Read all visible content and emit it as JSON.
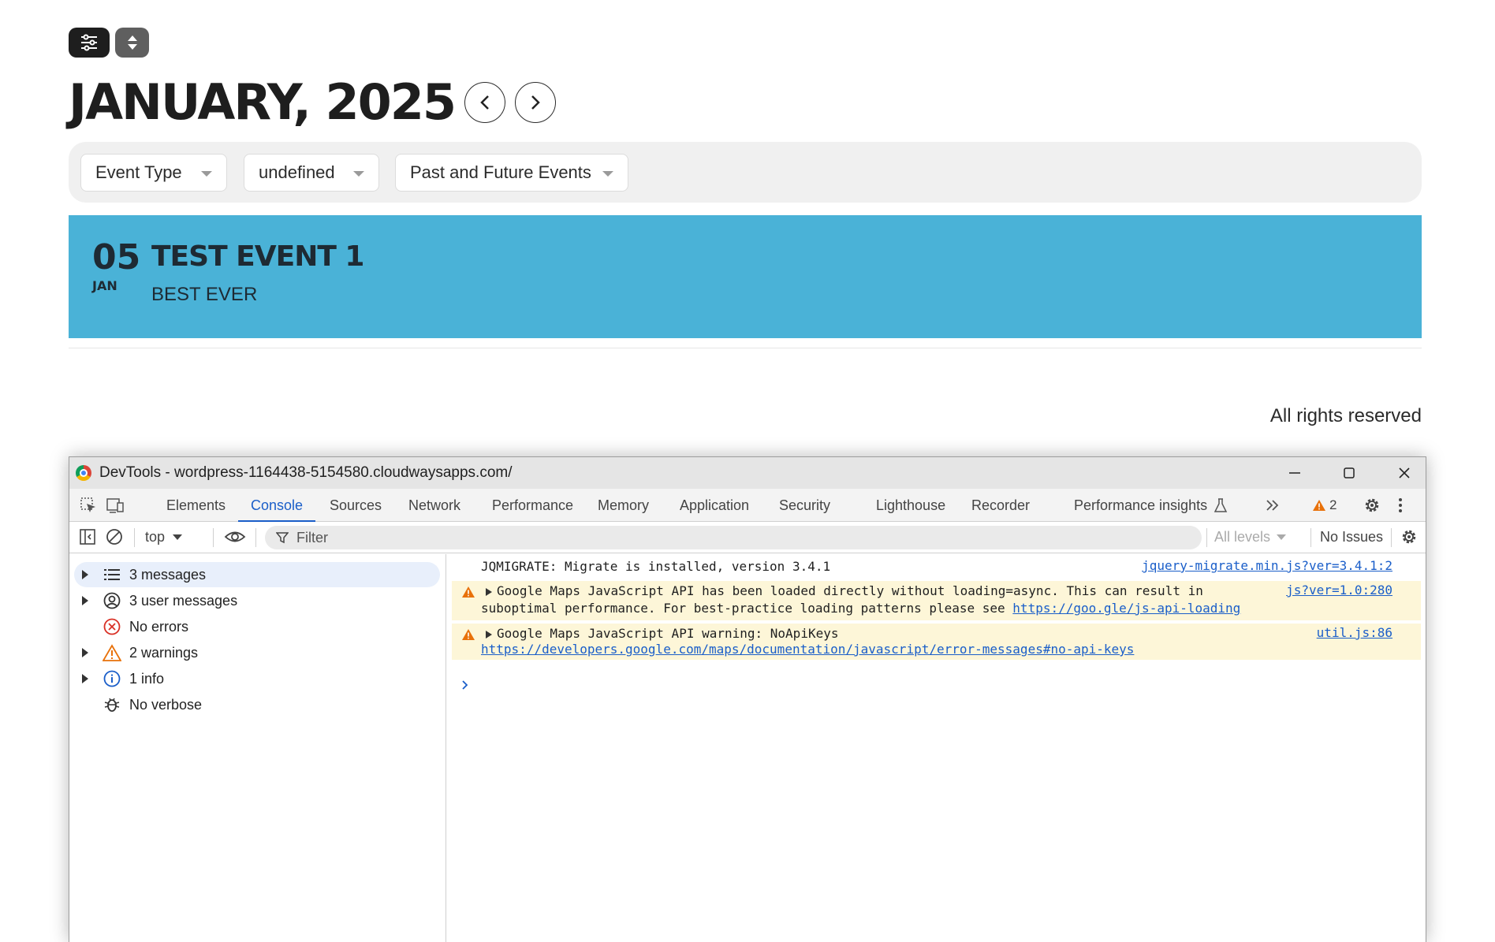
{
  "page": {
    "month_title": "JANUARY, 2025",
    "filters": {
      "event_type": "Event Type",
      "category": "undefined",
      "time_range": "Past and Future Events"
    },
    "event": {
      "day": "05",
      "month": "JAN",
      "title": "TEST EVENT 1",
      "subtitle": "BEST EVER"
    },
    "footer": "All rights reserved",
    "colors": {
      "event_card": "#4ab2d7",
      "filter_bar": "#f0f0f0"
    }
  },
  "devtools": {
    "window_title": "DevTools - wordpress-1164438-5154580.cloudwaysapps.com/",
    "tabs": [
      "Elements",
      "Console",
      "Sources",
      "Network",
      "Performance",
      "Memory",
      "Application",
      "Security",
      "Lighthouse",
      "Recorder",
      "Performance insights"
    ],
    "active_tab": "Console",
    "warning_count": "2",
    "toolbar": {
      "context": "top",
      "filter_placeholder": "Filter",
      "levels": "All levels",
      "issues": "No Issues"
    },
    "sidebar": [
      {
        "label": "3 messages",
        "icon": "list-icon"
      },
      {
        "label": "3 user messages",
        "icon": "user-icon"
      },
      {
        "label": "No errors",
        "icon": "error-icon"
      },
      {
        "label": "2 warnings",
        "icon": "warning-icon"
      },
      {
        "label": "1 info",
        "icon": "info-icon"
      },
      {
        "label": "No verbose",
        "icon": "bug-icon"
      }
    ],
    "messages": [
      {
        "text": "JQMIGRATE: Migrate is installed, version 3.4.1",
        "source": "jquery-migrate.min.js?ver=3.4.1:2"
      },
      {
        "text_line1": "Google Maps JavaScript API has been loaded directly without loading=async. This can result in",
        "text_line2": "suboptimal performance. For best-practice loading patterns please see ",
        "link": "https://goo.gle/js-api-loading",
        "source": "js?ver=1.0:280"
      },
      {
        "text_line1": "Google Maps JavaScript API warning: NoApiKeys",
        "link": "https://developers.google.com/maps/documentation/javascript/error-messages#no-api-keys",
        "source": "util.js:86"
      }
    ],
    "colors": {
      "accent": "#1a5ec9",
      "warning_bg": "#fdf6d8",
      "warning_icon": "#e8710a",
      "error": "#d93025"
    }
  }
}
